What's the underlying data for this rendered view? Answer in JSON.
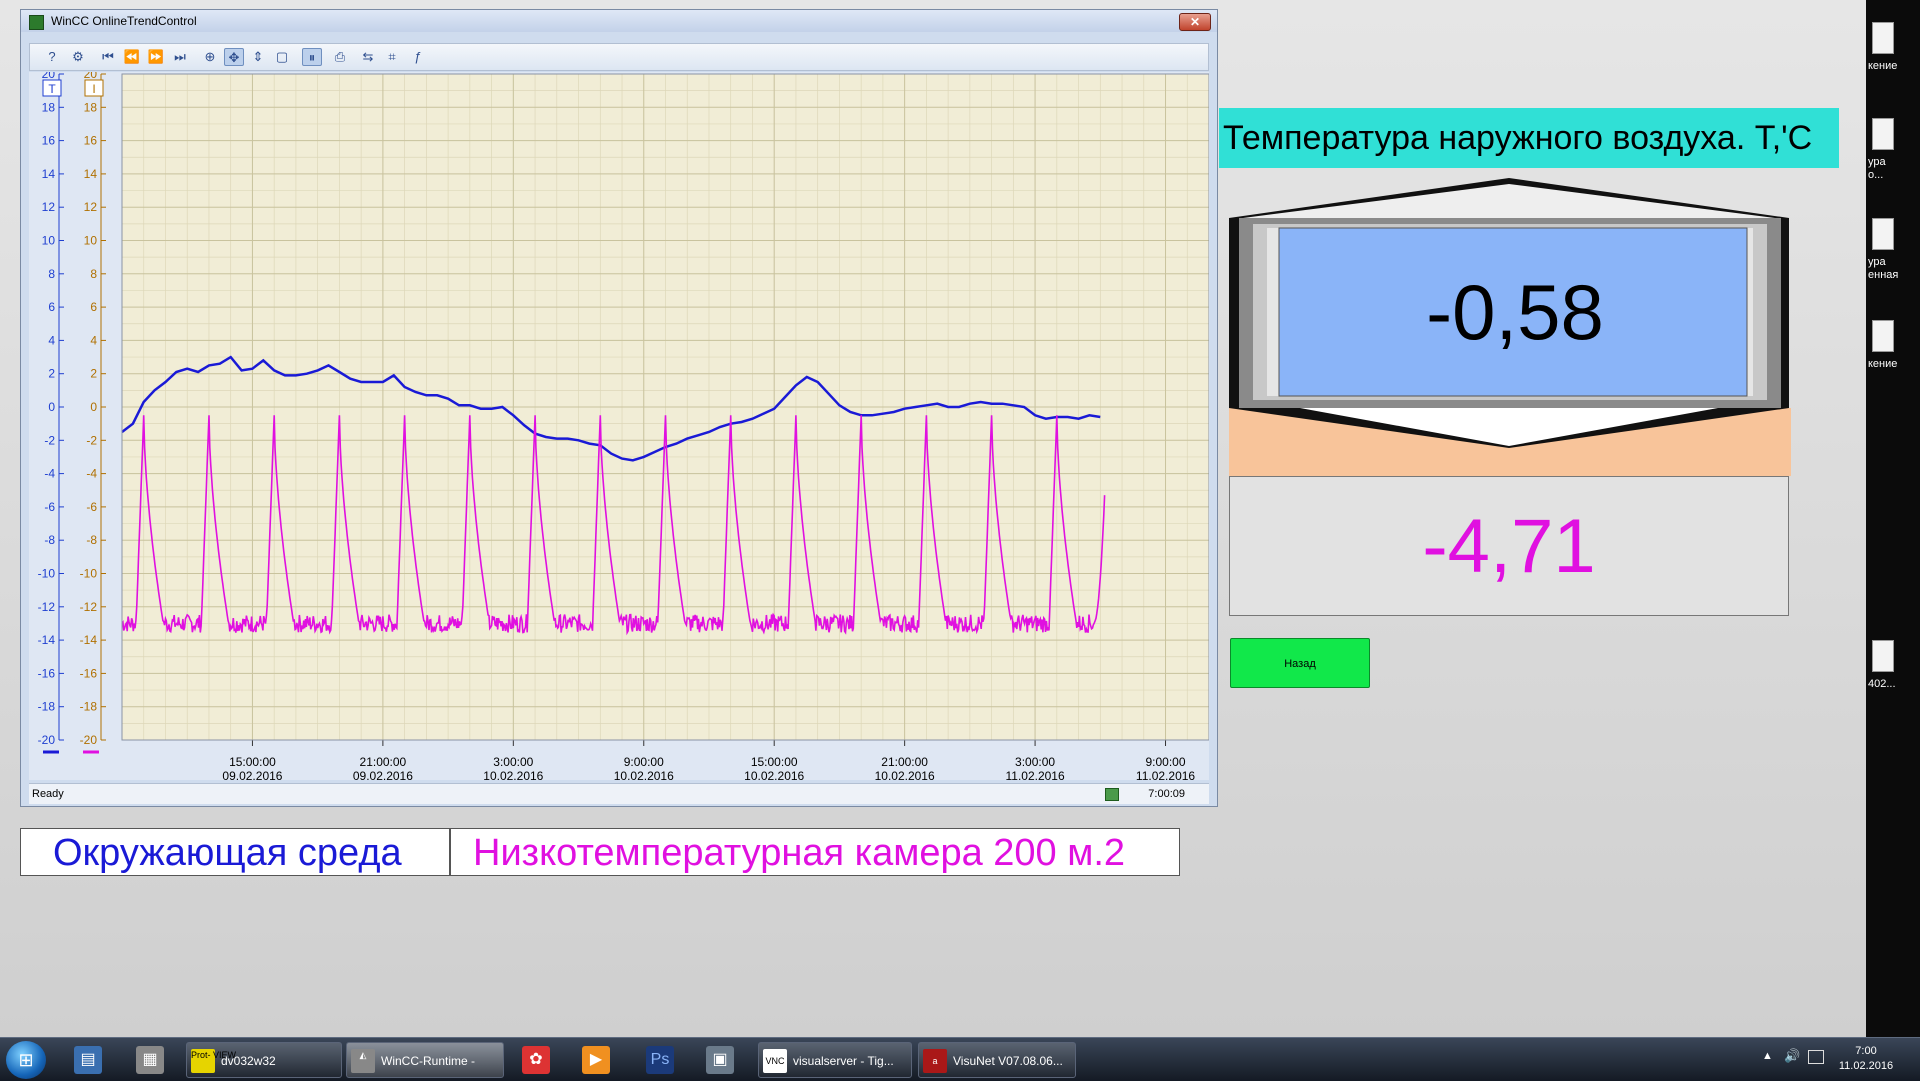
{
  "window": {
    "title": "WinCC OnlineTrendControl",
    "close_glyph": "✕",
    "status_ready": "Ready",
    "status_time": "7:00:09"
  },
  "toolbar": [
    {
      "icon": "help-icon",
      "glyph": "?"
    },
    {
      "icon": "configure-icon",
      "glyph": "⚙"
    },
    {
      "icon": "first-icon",
      "glyph": "⏮"
    },
    {
      "icon": "previous-icon",
      "glyph": "⏪"
    },
    {
      "icon": "next-icon",
      "glyph": "⏩"
    },
    {
      "icon": "last-icon",
      "glyph": "⏭"
    },
    {
      "icon": "zoom-area-icon",
      "glyph": "⊕"
    },
    {
      "icon": "move-axes-icon",
      "glyph": "✥"
    },
    {
      "icon": "move-time-axis-icon",
      "glyph": "⇕"
    },
    {
      "icon": "original-view-icon",
      "glyph": "▢"
    },
    {
      "icon": "start-stop-icon",
      "glyph": "⏸"
    },
    {
      "icon": "print-icon",
      "glyph": "⎙"
    },
    {
      "icon": "ruler-icon",
      "glyph": "⇆"
    },
    {
      "icon": "statistics-area-icon",
      "glyph": "⌗"
    },
    {
      "icon": "statistics-icon",
      "glyph": "ƒ"
    }
  ],
  "chart_data": {
    "type": "line",
    "y_axes": [
      {
        "label": "T",
        "color": "#1f3fd0"
      },
      {
        "label": "I",
        "color": "#b07000"
      }
    ],
    "ylim": [
      -20,
      20
    ],
    "yticks": [
      -20,
      -18,
      -16,
      -14,
      -12,
      -10,
      -8,
      -6,
      -4,
      -2,
      0,
      2,
      4,
      6,
      8,
      10,
      12,
      14,
      16,
      18,
      20
    ],
    "x_unit": "hours since 09.02.2016 09:00",
    "xlim": [
      0,
      50
    ],
    "xticks": [
      {
        "x": 6,
        "time": "15:00:00",
        "date": "09.02.2016"
      },
      {
        "x": 12,
        "time": "21:00:00",
        "date": "09.02.2016"
      },
      {
        "x": 18,
        "time": "3:00:00",
        "date": "10.02.2016"
      },
      {
        "x": 24,
        "time": "9:00:00",
        "date": "10.02.2016"
      },
      {
        "x": 30,
        "time": "15:00:00",
        "date": "10.02.2016"
      },
      {
        "x": 36,
        "time": "21:00:00",
        "date": "10.02.2016"
      },
      {
        "x": 42,
        "time": "3:00:00",
        "date": "11.02.2016"
      },
      {
        "x": 48,
        "time": "9:00:00",
        "date": "11.02.2016"
      }
    ],
    "grid": true,
    "series": [
      {
        "name": "Окружающая среда",
        "color": "#1a1ad6",
        "x": [
          0,
          0.5,
          1,
          1.5,
          2,
          2.5,
          3,
          3.5,
          4,
          4.5,
          5,
          5.5,
          6,
          6.5,
          7,
          7.5,
          8,
          8.5,
          9,
          9.5,
          10,
          10.5,
          11,
          11.5,
          12,
          12.5,
          13,
          13.5,
          14,
          14.5,
          15,
          15.5,
          16,
          16.5,
          17,
          17.5,
          18,
          18.5,
          19,
          19.5,
          20,
          20.5,
          21,
          21.5,
          22,
          22.5,
          23,
          23.5,
          24,
          24.5,
          25,
          25.5,
          26,
          26.5,
          27,
          27.5,
          28,
          28.5,
          29,
          29.5,
          30,
          30.5,
          31,
          31.5,
          32,
          32.5,
          33,
          33.5,
          34,
          34.5,
          35,
          35.5,
          36,
          36.5,
          37,
          37.5,
          38,
          38.5,
          39,
          39.5,
          40,
          40.5,
          41,
          41.5,
          42,
          42.5,
          43,
          43.5,
          44,
          44.5,
          45
        ],
        "y": [
          -1.5,
          -1.0,
          0.3,
          1.0,
          1.5,
          2.1,
          2.3,
          2.1,
          2.5,
          2.6,
          3.0,
          2.2,
          2.3,
          2.8,
          2.2,
          1.9,
          1.9,
          2.0,
          2.2,
          2.5,
          2.1,
          1.7,
          1.5,
          1.5,
          1.5,
          1.9,
          1.2,
          0.9,
          0.7,
          0.7,
          0.5,
          0.1,
          0.1,
          -0.1,
          -0.1,
          0.0,
          -0.5,
          -1.1,
          -1.6,
          -1.8,
          -1.9,
          -1.9,
          -2.0,
          -2.2,
          -2.3,
          -2.8,
          -3.1,
          -3.2,
          -3.0,
          -2.7,
          -2.4,
          -2.2,
          -1.9,
          -1.7,
          -1.5,
          -1.2,
          -1.0,
          -0.9,
          -0.7,
          -0.4,
          -0.1,
          0.6,
          1.3,
          1.8,
          1.5,
          0.8,
          0.1,
          -0.3,
          -0.5,
          -0.5,
          -0.4,
          -0.3,
          -0.1,
          0.0,
          0.1,
          0.2,
          0.0,
          0.0,
          0.2,
          0.3,
          0.2,
          0.2,
          0.1,
          0.0,
          -0.5,
          -0.7,
          -0.6,
          -0.6,
          -0.7,
          -0.5,
          -0.6
        ]
      },
      {
        "name": "Низкотемпературная камера 200 м.2",
        "color": "#e010e0",
        "baseline": -13.0,
        "noise": 0.55,
        "peaks_x": [
          1.0,
          4.0,
          7.0,
          10.0,
          13.0,
          16.0,
          19.0,
          22.0,
          25.0,
          28.0,
          31.0,
          34.0,
          37.0,
          40.0,
          43.0
        ],
        "peak_y": -0.5,
        "end_x": 45.2,
        "end_y": -5.3
      }
    ]
  },
  "legend": {
    "item1": "Окружающая среда",
    "item2": "Низкотемпературная камера 200 м.2"
  },
  "panel": {
    "header": "Температура наружного воздуха. Т,'С",
    "value_outside": "-0,58",
    "value_chamber": "-4,71",
    "back_button": "Назад",
    "colors": {
      "value_bg": "#8ab4f8",
      "accent": "#f8c49a",
      "header_bg": "#30e0d6",
      "button": "#11e84a"
    }
  },
  "desktop_icons": [
    {
      "label": "кение"
    },
    {
      "label": "ура\nо..."
    },
    {
      "label": "ура\nенная"
    },
    {
      "label": "кение"
    },
    {
      "label": "402..."
    }
  ],
  "taskbar": {
    "quick_launch": [
      {
        "icon": "explorer-icon",
        "glyph": "▤"
      },
      {
        "icon": "calculator-icon",
        "glyph": "▦"
      }
    ],
    "tasks": [
      {
        "label": "dv032w32",
        "icon": "protview-icon",
        "icon_text": "Prot-\nVIEW",
        "active": false
      },
      {
        "label": "WinCC-Runtime -",
        "icon": "wincc-icon",
        "icon_text": "◭",
        "active": true
      }
    ],
    "mid_icons": [
      {
        "icon": "paint-icon",
        "glyph": "✿"
      },
      {
        "icon": "media-player-icon",
        "glyph": "▶"
      },
      {
        "icon": "photoshop-icon",
        "glyph": "Ps"
      },
      {
        "icon": "network-computer-icon",
        "glyph": "▣"
      }
    ],
    "tasks2": [
      {
        "label": "visualserver - Tig...",
        "icon": "vnc-icon",
        "icon_text": "VNC"
      },
      {
        "label": "VisuNet V07.08.06...",
        "icon": "visunet-icon",
        "icon_text": "a"
      }
    ],
    "tray_arrow": "▲",
    "tray_sound": "🔊",
    "clock_time": "7:00",
    "clock_date": "11.02.2016"
  }
}
